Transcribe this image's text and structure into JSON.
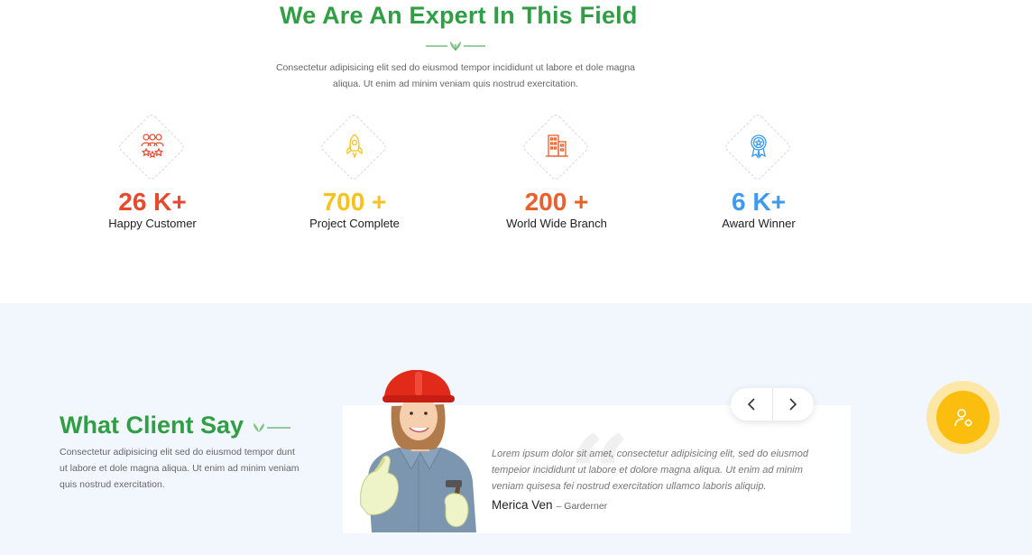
{
  "expert": {
    "title": "We Are An Expert In This Field",
    "description_line1": "Consectetur adipisicing elit sed do eiusmod tempor incididunt ut labore et dole magna",
    "description_line2": "aliqua. Ut enim ad minim veniam quis nostrud exercitation."
  },
  "stats": [
    {
      "icon": "team-icon",
      "value": "26 K+",
      "label": "Happy Customer",
      "color": "#e8492c"
    },
    {
      "icon": "rocket-icon",
      "value": "700 +",
      "label": "Project Complete",
      "color": "#f7c21c"
    },
    {
      "icon": "building-icon",
      "value": "200 +",
      "label": "World Wide Branch",
      "color": "#e8612c"
    },
    {
      "icon": "award-icon",
      "value": "6 K+",
      "label": "Award Winner",
      "color": "#3d9af0"
    }
  ],
  "client": {
    "title": "What Client Say",
    "description_line1": "Consectetur adipisicing elit sed do eiusmod tempor dunt",
    "description_line2": "ut labore et dole magna aliqua. Ut enim ad minim veniam",
    "description_line3": "quis nostrud exercitation."
  },
  "testimonial": {
    "text_line1": "Lorem ipsum dolor sit amet, consectetur adipisicing elit, sed do eiusmod",
    "text_line2": "tempeior incididunt ut labore et dolore magna aliqua. Ut enim ad minim",
    "text_line3": "veniam quisesa fei nostrud exercitation ullamco laboris aliquip.",
    "name": "Merica Ven",
    "role": "– Garderner"
  },
  "colors": {
    "accent_green": "#2f9e44",
    "fab_yellow": "#fbbe0f"
  }
}
